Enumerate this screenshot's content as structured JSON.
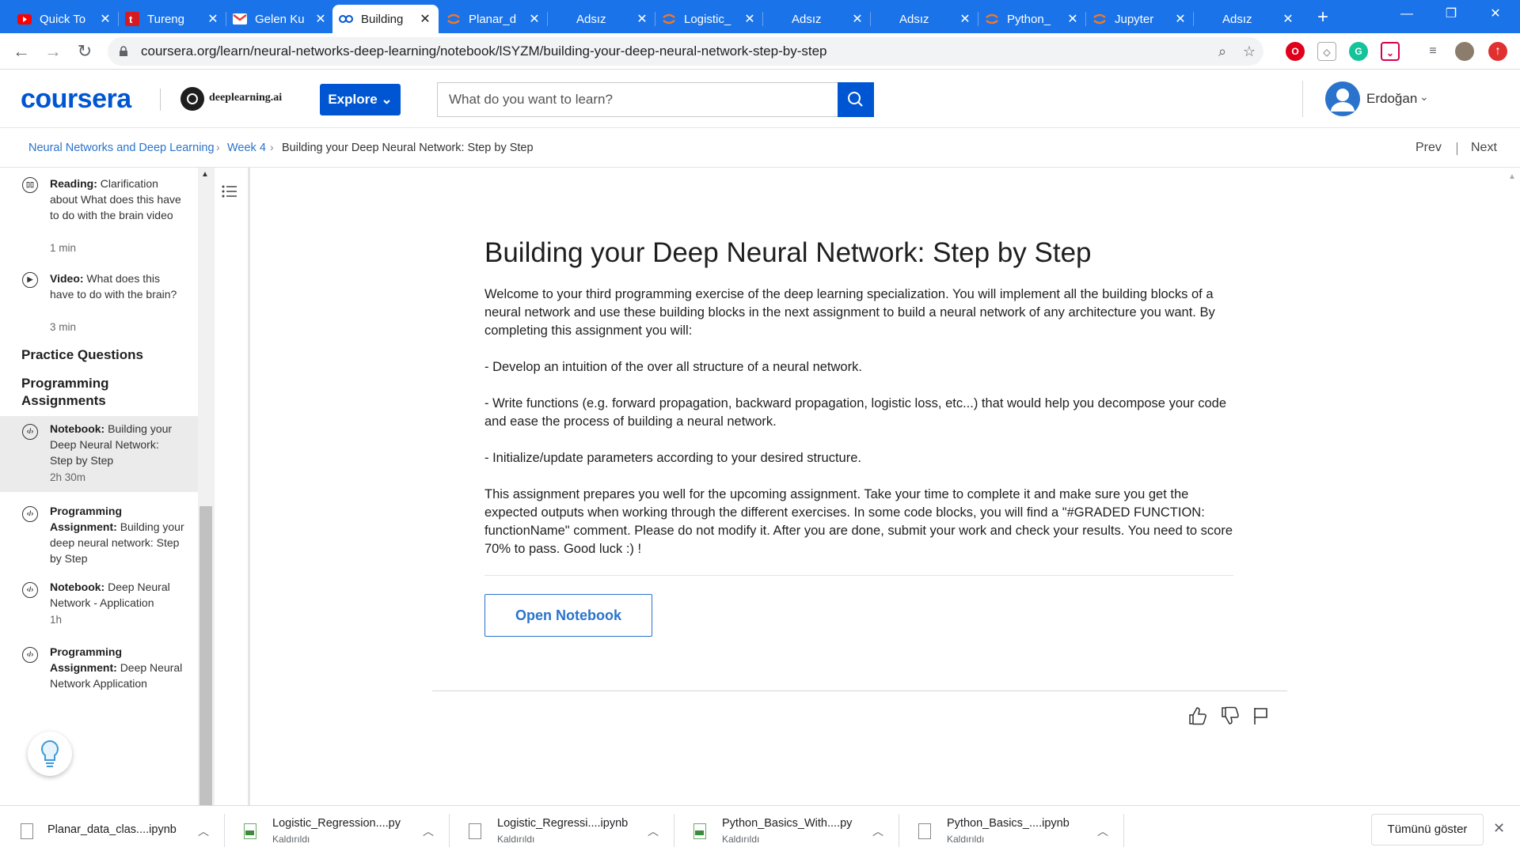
{
  "browser": {
    "tabs": [
      {
        "title": "Quick To",
        "icon": "youtube-icon",
        "color": "#ff0000"
      },
      {
        "title": "Tureng",
        "icon": "tureng-icon",
        "color": "#d71920"
      },
      {
        "title": "Gelen Ku",
        "icon": "gmail-icon",
        "color": "#ea4335"
      },
      {
        "title": "Building",
        "icon": "coursera-tab-icon",
        "color": "#0056d2"
      },
      {
        "title": "Planar_d",
        "icon": "jupyter-icon",
        "color": "#f37626"
      },
      {
        "title": "Adsız",
        "icon": "",
        "color": ""
      },
      {
        "title": "Logistic_",
        "icon": "jupyter-icon",
        "color": "#f37626"
      },
      {
        "title": "Adsız",
        "icon": "",
        "color": ""
      },
      {
        "title": "Adsız",
        "icon": "",
        "color": ""
      },
      {
        "title": "Python_",
        "icon": "jupyter-icon",
        "color": "#f37626"
      },
      {
        "title": "Jupyter",
        "icon": "jupyter-icon",
        "color": "#f37626"
      },
      {
        "title": "Adsız",
        "icon": "",
        "color": ""
      }
    ],
    "url": "coursera.org/learn/neural-networks-deep-learning/notebook/lSYZM/building-your-deep-neural-network-step-by-step",
    "accent": "#1a73e8"
  },
  "header": {
    "logo": "coursera",
    "partner": "deeplearning.ai",
    "explore_label": "Explore",
    "search_placeholder": "What do you want to learn?",
    "username": "Erdoğan",
    "brand_color": "#0056d2"
  },
  "breadcrumb": {
    "items": [
      "Neural Networks and Deep Learning",
      "Week 4",
      "Building your Deep Neural Network: Step by Step"
    ],
    "prev": "Prev",
    "next": "Next"
  },
  "sidebar": {
    "items": [
      {
        "type": "Reading:",
        "title": "Clarification about What does this have to do with the brain video",
        "duration": "1 min",
        "icon": "reading-icon"
      },
      {
        "type": "Video:",
        "title": "What does this have to do with the brain?",
        "duration": "3 min",
        "icon": "play-icon"
      }
    ],
    "section_practice": "Practice Questions",
    "section_programming": "Programming Assignments",
    "assignments": [
      {
        "type": "Notebook:",
        "title": "Building your Deep Neural Network: Step by Step",
        "duration": "2h 30m",
        "selected": true
      },
      {
        "type": "Programming Assignment:",
        "title": "Building your deep neural network: Step by Step",
        "duration": ""
      },
      {
        "type": "Notebook:",
        "title": "Deep Neural Network - Application",
        "duration": "1h"
      },
      {
        "type": "Programming Assignment:",
        "title": "Deep Neural Network Application",
        "duration": ""
      }
    ]
  },
  "main": {
    "title": "Building your Deep Neural Network: Step by Step",
    "paragraphs": [
      "Welcome to your third programming exercise of the deep learning specialization. You will implement all the building blocks of a neural network and use these building blocks in the next assignment to build a neural network of any architecture you want. By completing this assignment you will:",
      "- Develop an intuition of the over all structure of a neural network.",
      "- Write functions (e.g. forward propagation, backward propagation, logistic loss, etc...) that would help you decompose your code and ease the process of building a neural network.",
      "- Initialize/update parameters according to your desired structure.",
      "This assignment prepares you well for the upcoming assignment. Take your time to complete it and make sure you get the expected outputs when working through the different exercises. In some code blocks, you will find a \"#GRADED FUNCTION: functionName\" comment. Please do not modify it. After you are done, submit your work and check your results. You need to score 70% to pass. Good luck :) !"
    ],
    "open_button": "Open Notebook"
  },
  "downloads": {
    "items": [
      {
        "name": "Planar_data_clas....ipynb",
        "status": "",
        "kind": "ipynb"
      },
      {
        "name": "Logistic_Regression....py",
        "status": "Kaldırıldı",
        "kind": "py"
      },
      {
        "name": "Logistic_Regressi....ipynb",
        "status": "Kaldırıldı",
        "kind": "ipynb"
      },
      {
        "name": "Python_Basics_With....py",
        "status": "Kaldırıldı",
        "kind": "py"
      },
      {
        "name": "Python_Basics_....ipynb",
        "status": "Kaldırıldı",
        "kind": "ipynb"
      }
    ],
    "show_all": "Tümünü göster"
  }
}
